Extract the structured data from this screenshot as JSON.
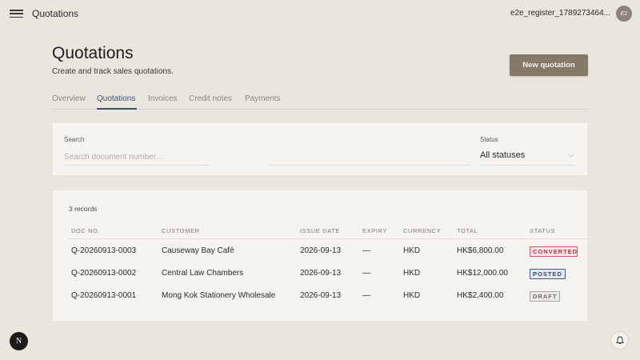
{
  "topbar": {
    "app_title": "Quotations",
    "user_name": "e2e_register_1789273464...",
    "avatar_initials": "E2"
  },
  "header": {
    "title": "Quotations",
    "subtitle": "Create and track sales quotations.",
    "new_button_label": "New quotation"
  },
  "tabs": [
    {
      "label": "Overview",
      "active": false
    },
    {
      "label": "Quotations",
      "active": true
    },
    {
      "label": "Invoices",
      "active": false
    },
    {
      "label": "Credit notes",
      "active": false
    },
    {
      "label": "Payments",
      "active": false
    }
  ],
  "filters": {
    "search_label": "Search",
    "search_placeholder": "Search document number...",
    "status_label": "Status",
    "status_value": "All statuses"
  },
  "table": {
    "records_count": "3 records",
    "columns": [
      "DOC NO.",
      "CUSTOMER",
      "ISSUE DATE",
      "EXPIRY",
      "CURRENCY",
      "TOTAL",
      "STATUS"
    ],
    "rows": [
      {
        "doc_no": "Q-20260913-0003",
        "customer": "Causeway Bay Café",
        "issue_date": "2026-09-13",
        "expiry": "—",
        "currency": "HKD",
        "total": "HK$6,800.00",
        "status": "CONVERTED"
      },
      {
        "doc_no": "Q-20260913-0002",
        "customer": "Central Law Chambers",
        "issue_date": "2026-09-13",
        "expiry": "—",
        "currency": "HKD",
        "total": "HK$12,000.00",
        "status": "POSTED"
      },
      {
        "doc_no": "Q-20260913-0001",
        "customer": "Mong Kok Stationery Wholesale",
        "issue_date": "2026-09-13",
        "expiry": "—",
        "currency": "HKD",
        "total": "HK$2,400.00",
        "status": "DRAFT"
      }
    ]
  },
  "floating": {
    "n_badge_letter": "N"
  },
  "colors": {
    "accent": "#857a68",
    "active_tab": "#3c4f6b",
    "converted": "#b33a4e",
    "posted": "#34496b",
    "draft": "#6f6c66"
  }
}
